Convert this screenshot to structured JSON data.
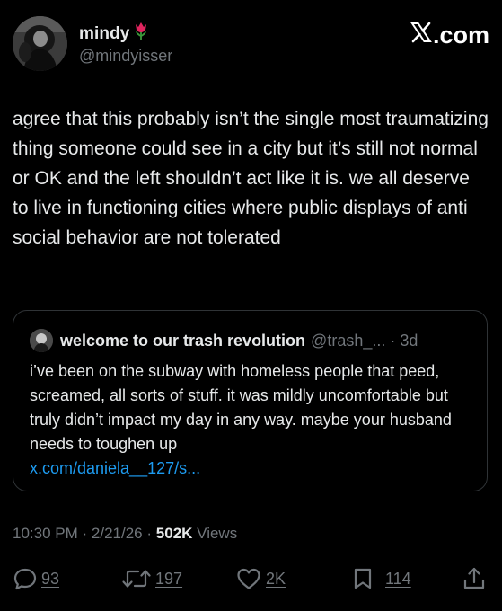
{
  "author": {
    "display_name": "mindy",
    "emoji_icon": "tulip-icon",
    "handle": "@mindyisser"
  },
  "brand": {
    "label": ".com",
    "logo_icon": "x-logo-icon"
  },
  "tweet": {
    "text": "agree that this probably isn’t the single most traumatizing thing someone could see in a city but it’s still not normal or OK and the left shouldn’t act like it is. we all deserve to live in functioning cities where public displays of anti social behavior are not tolerated"
  },
  "quote": {
    "name": "welcome to our trash revolution",
    "meta": "@trash_... · 3d",
    "text": "i’ve been on the subway with homeless people that peed, screamed, all sorts of stuff. it was mildly uncomfortable but truly didn’t impact my day in any way. maybe your husband needs to toughen up",
    "link": "x.com/daniela__127/s..."
  },
  "timestamp": {
    "time": "10:30 PM",
    "date": "2/21/26",
    "views_count": "502K",
    "views_label": "Views"
  },
  "actions": {
    "replies": "93",
    "reposts": "197",
    "likes": "2K",
    "bookmarks": "114"
  },
  "colors": {
    "background": "#000000",
    "text": "#e7e9ea",
    "secondary": "#71767b",
    "link": "#1d9bf0",
    "border": "#2f3336",
    "tulip": "#e0245e"
  }
}
